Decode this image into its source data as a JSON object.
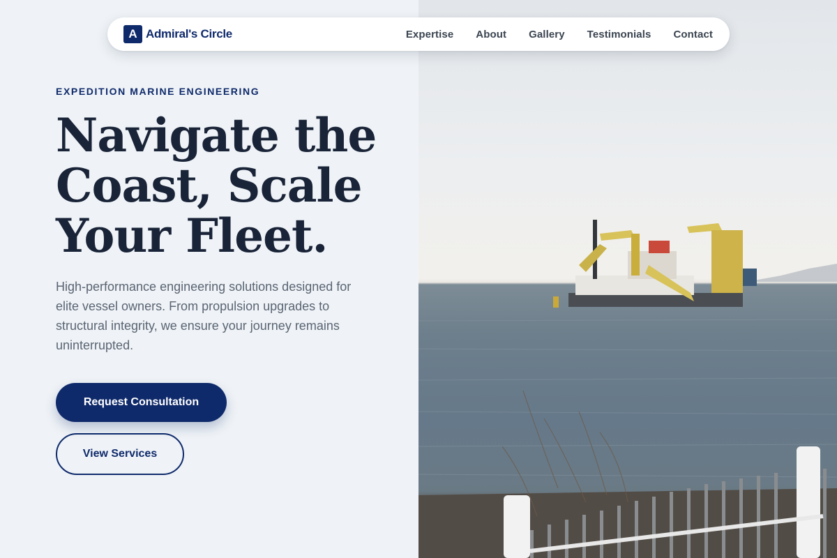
{
  "brand": {
    "logo_letter": "A",
    "name": "Admiral's Circle"
  },
  "nav": {
    "links": [
      "Expertise",
      "About",
      "Gallery",
      "Testimonials",
      "Contact"
    ]
  },
  "hero": {
    "eyebrow": "EXPEDITION MARINE ENGINEERING",
    "headline_lines": [
      "Navigate the",
      "Coast, Scale",
      "Your Fleet."
    ],
    "description": "High-performance engineering solutions designed for elite vessel owners. From propulsion upgrades to structural integrity, we ensure your journey remains uninterrupted.",
    "primary_cta": "Request Consultation",
    "secondary_cta": "View Services"
  },
  "colors": {
    "brand_navy": "#0f2a6b",
    "heading": "#1a2438",
    "body_text": "#5a6472",
    "background": "#eff3f7"
  },
  "icons": {
    "logo": "letter-a-badge"
  }
}
